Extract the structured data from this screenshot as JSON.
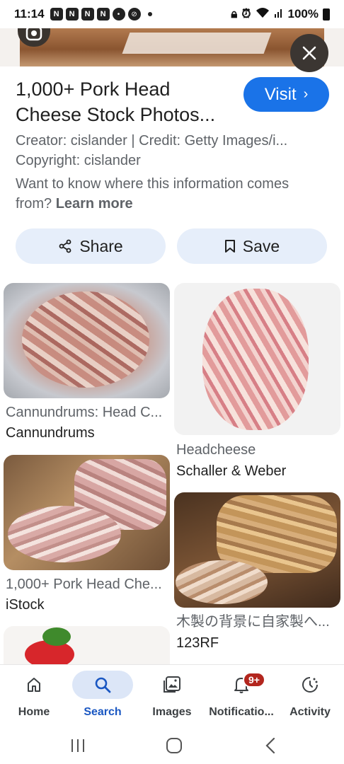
{
  "status_bar": {
    "time": "11:14",
    "battery": "100%"
  },
  "result": {
    "title": "1,000+ Pork Head Cheese Stock Photos...",
    "visit_label": "Visit",
    "creator_line": "Creator: cislander | Credit: Getty Images/i...",
    "copyright_line": "Copyright: cislander",
    "info_text": "Want to know where this information comes from?",
    "learn_more": "Learn more",
    "share_label": "Share",
    "save_label": "Save"
  },
  "grid": [
    {
      "title": "Cannundrums: Head C...",
      "source": "Cannundrums"
    },
    {
      "title": "Headcheese",
      "source": "Schaller & Weber"
    },
    {
      "title": "1,000+ Pork Head Che...",
      "source": "iStock"
    },
    {
      "title": "木製の背景に自家製へ...",
      "source": "123RF"
    }
  ],
  "bottom_nav": {
    "items": [
      {
        "label": "Home",
        "icon": "home-icon"
      },
      {
        "label": "Search",
        "icon": "search-icon"
      },
      {
        "label": "Images",
        "icon": "images-icon"
      },
      {
        "label": "Notificatio...",
        "icon": "bell-icon",
        "badge": "9+"
      },
      {
        "label": "Activity",
        "icon": "activity-icon"
      }
    ],
    "active": "Search"
  },
  "colors": {
    "accent": "#1a73e8",
    "pill_bg": "#e6eefa",
    "badge": "#b3261e"
  }
}
